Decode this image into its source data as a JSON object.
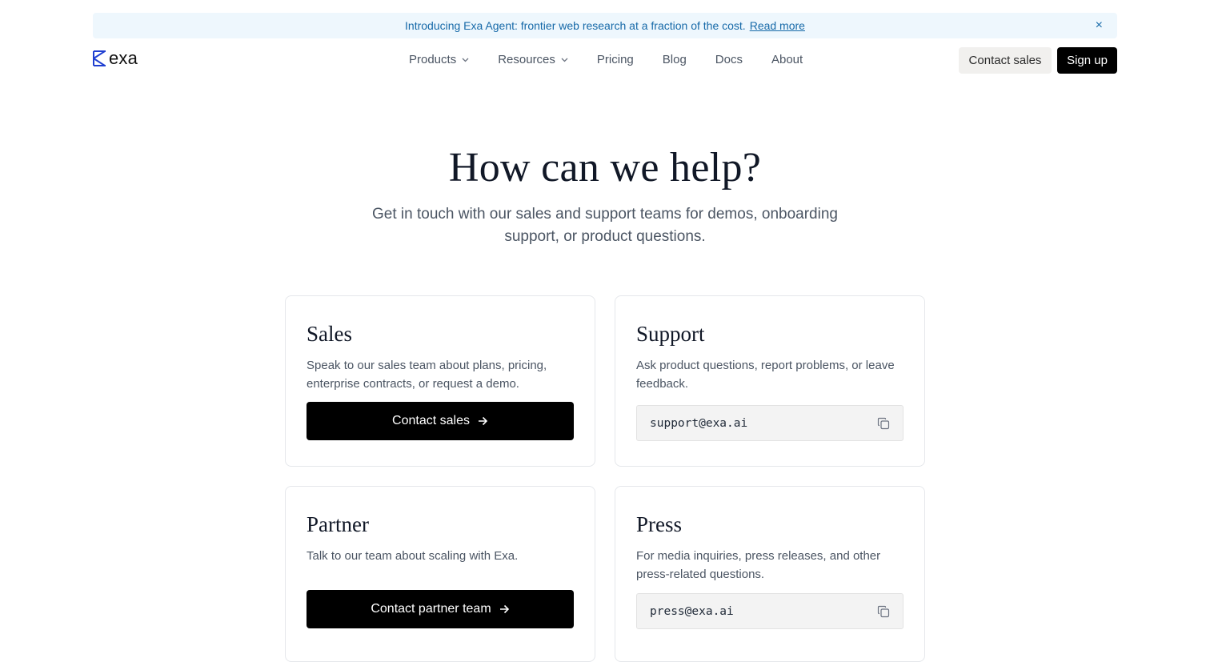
{
  "banner": {
    "text": "Introducing Exa Agent: frontier web research at a fraction of the cost.",
    "link": "Read more",
    "close": "×"
  },
  "header": {
    "logo_text": "exa",
    "nav": [
      {
        "label": "Products"
      },
      {
        "label": "Resources"
      },
      {
        "label": "Pricing"
      },
      {
        "label": "Blog"
      },
      {
        "label": "Docs"
      },
      {
        "label": "About"
      }
    ],
    "contact_sales": "Contact sales",
    "sign_up": "Sign up"
  },
  "hero": {
    "title": "How can we help?",
    "subtitle": "Get in touch with our sales and support teams for demos, onboarding support, or product questions."
  },
  "cards": {
    "sales": {
      "title": "Sales",
      "description": "Speak to our sales team about plans, pricing, enterprise contracts, or request a demo.",
      "button": "Contact sales"
    },
    "support": {
      "title": "Support",
      "description": "Ask product questions, report problems, or leave feedback.",
      "email": "support@exa.ai"
    },
    "partner": {
      "title": "Partner",
      "description": "Talk to our team about scaling with Exa.",
      "button": "Contact partner team"
    },
    "press": {
      "title": "Press",
      "description": "For media inquiries, press releases, and other press-related questions.",
      "email": "press@exa.ai"
    }
  },
  "icons": {
    "logo": "exa-logo-icon",
    "close": "close-icon",
    "dropdown": "chevron-down-icon",
    "arrow": "arrow-right-icon",
    "copy": "copy-icon"
  },
  "colors": {
    "banner_bg": "#eef7fd",
    "banner_text": "#1669a8",
    "logo_blue": "#1f3fd1",
    "primary_button": "#000000",
    "secondary_button": "#f1f0ee"
  }
}
